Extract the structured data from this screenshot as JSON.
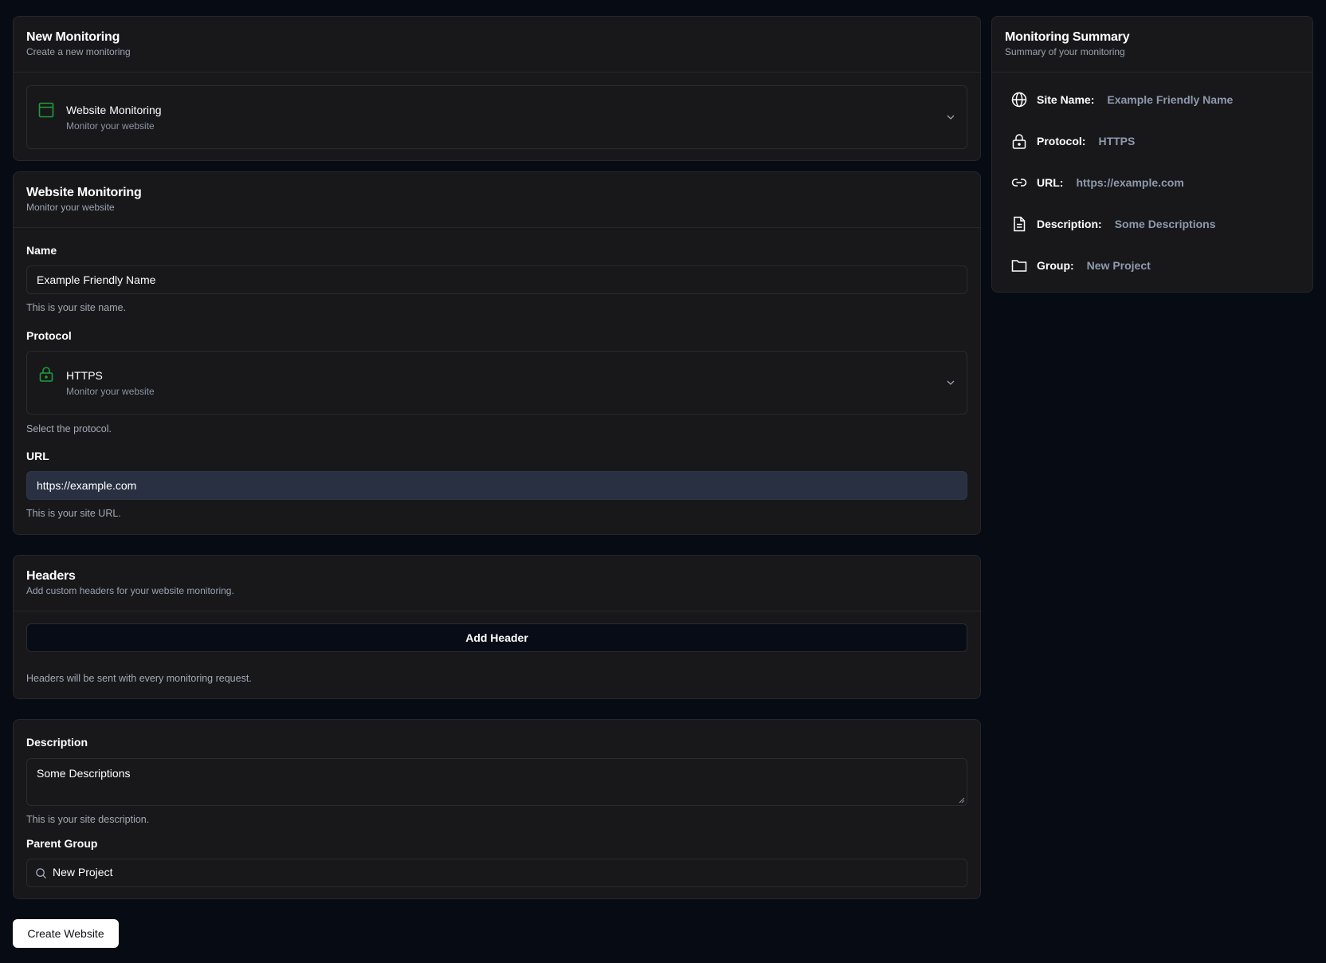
{
  "new_monitoring": {
    "title": "New Monitoring",
    "subtitle": "Create a new monitoring",
    "type_select": {
      "title": "Website Monitoring",
      "subtitle": "Monitor your website",
      "icon": "browser-window-icon"
    }
  },
  "website_monitoring": {
    "title": "Website Monitoring",
    "subtitle": "Monitor your website",
    "name": {
      "label": "Name",
      "value": "Example Friendly Name",
      "hint": "This is your site name."
    },
    "protocol": {
      "label": "Protocol",
      "selected": "HTTPS",
      "selected_sub": "Monitor your website",
      "hint": "Select the protocol.",
      "icon": "lock-icon"
    },
    "url": {
      "label": "URL",
      "value": "https://example.com",
      "hint": "This is your site URL."
    }
  },
  "headers": {
    "title": "Headers",
    "subtitle": "Add custom headers for your website monitoring.",
    "add_button": "Add Header",
    "hint": "Headers will be sent with every monitoring request."
  },
  "details": {
    "description": {
      "label": "Description",
      "value": "Some Descriptions",
      "hint": "This is your site description."
    },
    "parent_group": {
      "label": "Parent Group",
      "value": "New Project"
    }
  },
  "create_button": "Create Website",
  "summary": {
    "title": "Monitoring Summary",
    "subtitle": "Summary of your monitoring",
    "rows": [
      {
        "key": "Site Name:",
        "value": "Example Friendly Name",
        "icon": "globe-icon"
      },
      {
        "key": "Protocol:",
        "value": "HTTPS",
        "icon": "lock-icon"
      },
      {
        "key": "URL:",
        "value": "https://example.com",
        "icon": "link-icon"
      },
      {
        "key": "Description:",
        "value": "Some Descriptions",
        "icon": "file-text-icon"
      },
      {
        "key": "Group:",
        "value": "New Project",
        "icon": "folder-icon"
      }
    ]
  },
  "colors": {
    "background": "#060b14",
    "card": "#18181b",
    "accent_green": "#1f9d3a",
    "url_input_bg": "#283042"
  }
}
